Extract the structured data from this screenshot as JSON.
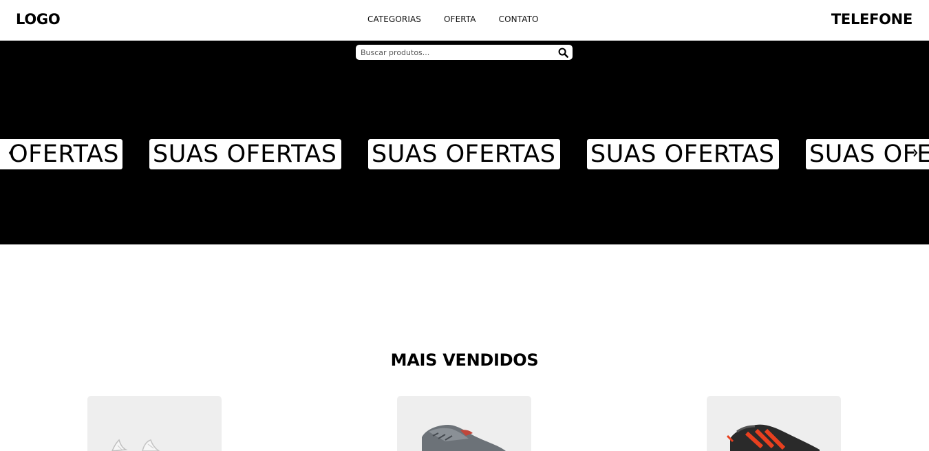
{
  "header": {
    "logo": "LOGO",
    "nav": [
      {
        "label": "CATEGORIAS"
      },
      {
        "label": "OFERTA"
      },
      {
        "label": "CONTATO"
      }
    ],
    "phone": "TELEFONE"
  },
  "search": {
    "placeholder": "Buscar produtos...",
    "icon": "search-icon"
  },
  "banner": {
    "items": [
      {
        "label": "OFERTAS"
      },
      {
        "label": "SUAS OFERTAS"
      },
      {
        "label": "SUAS OFERTAS"
      },
      {
        "label": "SUAS OFERTAS"
      },
      {
        "label": "SUAS OFE"
      }
    ],
    "background": "#000000",
    "prev_icon": "chevron-left-icon",
    "next_icon": "chevron-right-icon"
  },
  "section": {
    "title": "MAIS VENDIDOS"
  },
  "products": [
    {
      "name": "white-sneaker"
    },
    {
      "name": "grey-sneaker"
    },
    {
      "name": "black-red-sneaker"
    }
  ],
  "colors": {
    "card_bg": "#eeeeee",
    "accent_red": "#e8401f"
  }
}
